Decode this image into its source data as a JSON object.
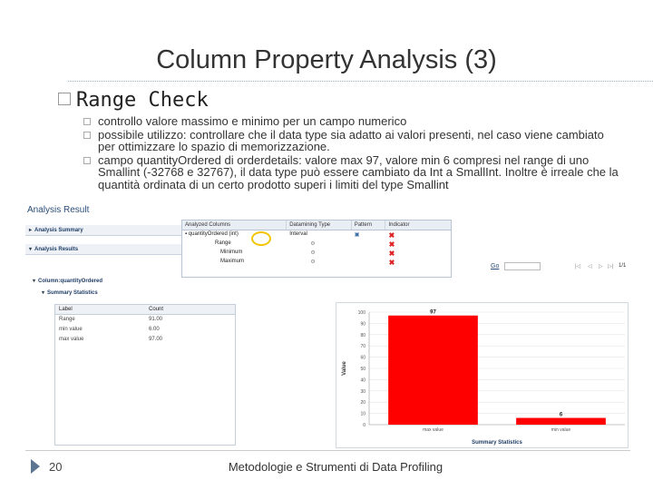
{
  "slide": {
    "title": "Column Property Analysis (3)",
    "main_bullet": "Range Check",
    "subs": [
      "controllo valore massimo e minimo per un campo numerico",
      "possibile utilizzo: controllare che il data type sia adatto ai valori presenti, nel caso viene cambiato per ottimizzare lo spazio di memorizzazione.",
      "campo quantityOrdered di orderdetails: valore max 97, valore min 6 compresi nel range di uno Smallint (-32768 e 32767), il data type può essere cambiato da Int a SmallInt. Inoltre è irreale che la quantità ordinata di un certo prodotto superi i limiti del type Smallint"
    ],
    "page_number": "20",
    "footer": "Metodologie e Strumenti di Data Profiling"
  },
  "screenshot": {
    "title": "Analysis Result",
    "analysis_summary": "Analysis Summary",
    "analysis_results": "Analysis Results",
    "column_section": "Column:quantityOrdered",
    "summary_stats_section": "Summary Statistics",
    "columns_table": {
      "headers": [
        "Analyzed Columns",
        "Datamining Type",
        "Pattern",
        "Indicator"
      ],
      "column_name": "quantityOrdered (int)",
      "datamining_type": "Interval",
      "indicators": [
        "Range",
        "Minimum",
        "Maximum"
      ]
    },
    "go_label": "Go",
    "page_indicator": "1/1",
    "stats_table": {
      "headers": [
        "Label",
        "Count"
      ],
      "rows": [
        {
          "label": "Range",
          "count": "91.00"
        },
        {
          "label": "min value",
          "count": "6.00"
        },
        {
          "label": "max value",
          "count": "97.00"
        }
      ]
    },
    "chart_data": {
      "type": "bar",
      "categories": [
        "max value",
        "min value"
      ],
      "values": [
        97,
        6
      ],
      "data_labels": [
        "97",
        "6"
      ],
      "ylabel": "Value",
      "xlabel": "Summary Statistics",
      "ylim": [
        0,
        100
      ],
      "yticks": [
        0,
        10,
        20,
        30,
        40,
        50,
        60,
        70,
        80,
        90,
        100
      ],
      "colors": {
        "bar": "#ff0000"
      }
    }
  }
}
